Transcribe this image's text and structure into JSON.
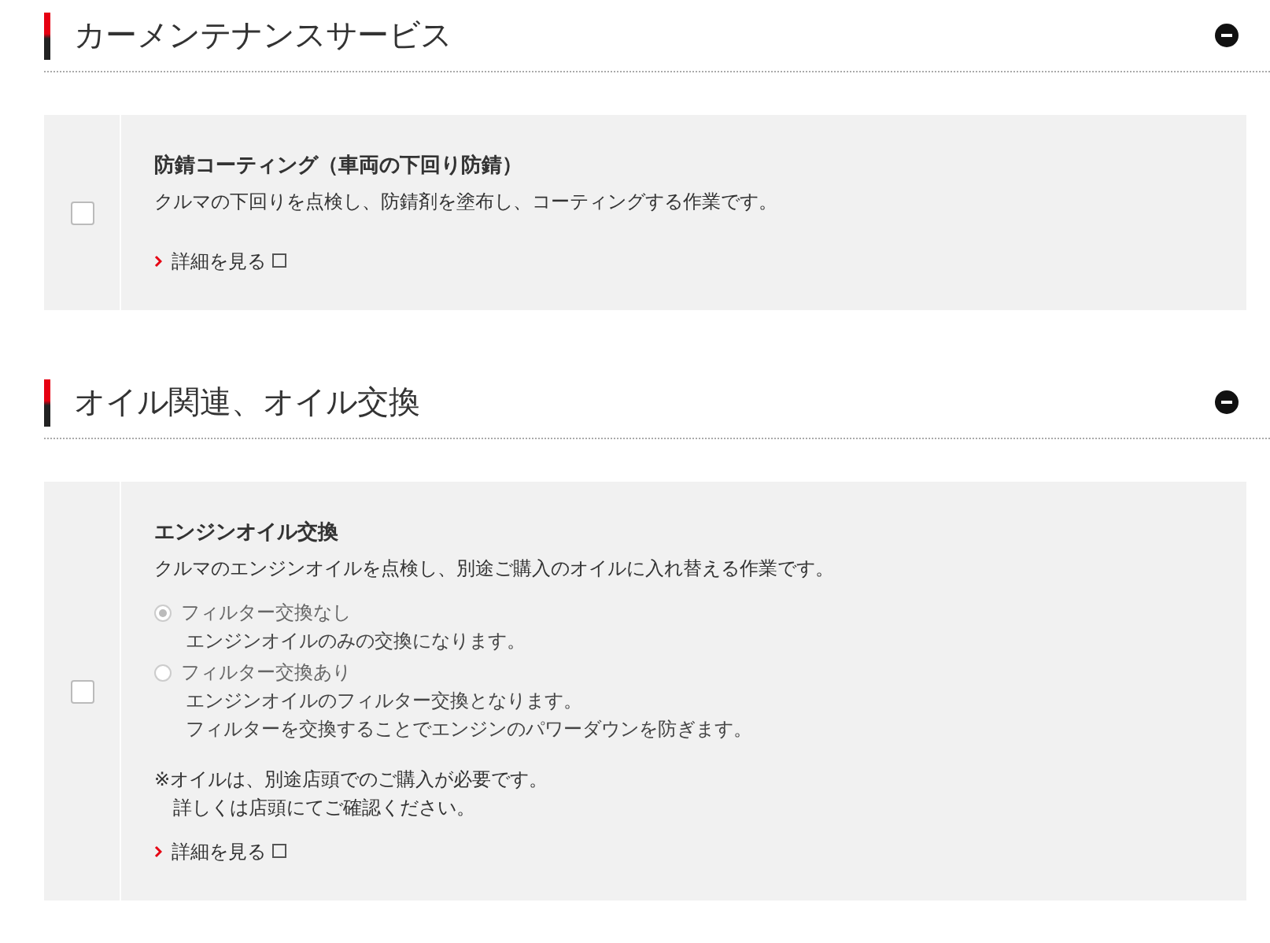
{
  "sections": [
    {
      "title": "カーメンテナンスサービス",
      "expanded": true,
      "items": [
        {
          "checked": false,
          "title": "防錆コーティング（車両の下回り防錆）",
          "description": "クルマの下回りを点検し、防錆剤を塗布し、コーティングする作業です。",
          "link": "詳細を見る"
        }
      ]
    },
    {
      "title": "オイル関連、オイル交換",
      "expanded": true,
      "items": [
        {
          "checked": false,
          "title": "エンジンオイル交換",
          "description": "クルマのエンジンオイルを点検し、別途ご購入のオイルに入れ替える作業です。",
          "options": [
            {
              "label": "フィルター交換なし",
              "selected": true,
              "lines": [
                "エンジンオイルのみの交換になります。"
              ]
            },
            {
              "label": "フィルター交換あり",
              "selected": false,
              "lines": [
                "エンジンオイルのフィルター交換となります。",
                "フィルターを交換することでエンジンのパワーダウンを防ぎます。"
              ]
            }
          ],
          "notes": [
            "※オイルは、別途店頭でのご購入が必要です。",
            "詳しくは店頭にてご確認ください。"
          ],
          "link": "詳細を見る"
        }
      ]
    }
  ]
}
